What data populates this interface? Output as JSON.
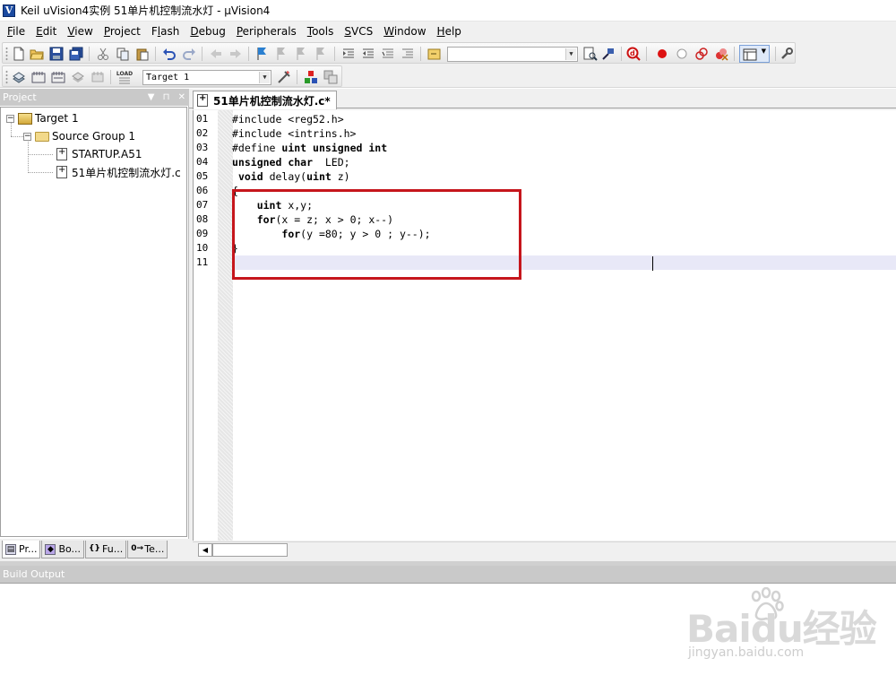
{
  "window": {
    "title": "Keil uVision4实例 51单片机控制流水灯  - µVision4"
  },
  "menu": {
    "items": [
      {
        "label": "File",
        "key": "F",
        "rest": "ile"
      },
      {
        "label": "Edit",
        "key": "E",
        "rest": "dit"
      },
      {
        "label": "View",
        "key": "V",
        "rest": "iew"
      },
      {
        "label": "Project",
        "key": "P",
        "rest": "roject"
      },
      {
        "label": "Flash",
        "key": "l",
        "pre": "F",
        "rest": "ash"
      },
      {
        "label": "Debug",
        "key": "D",
        "rest": "ebug"
      },
      {
        "label": "Peripherals",
        "key": "P",
        "rest": "eripherals"
      },
      {
        "label": "Tools",
        "key": "T",
        "rest": "ools"
      },
      {
        "label": "SVCS",
        "key": "S",
        "rest": "VCS"
      },
      {
        "label": "Window",
        "key": "W",
        "rest": "indow"
      },
      {
        "label": "Help",
        "key": "H",
        "rest": "elp"
      }
    ]
  },
  "toolbar": {
    "find_combo_value": "",
    "target_combo_value": "Target 1",
    "load_label": "LOAD"
  },
  "project_panel": {
    "title": "Project",
    "tree": {
      "target": "Target 1",
      "group": "Source Group 1",
      "files": [
        "STARTUP.A51",
        "51单片机控制流水灯.c"
      ]
    },
    "tabs": [
      "Pr...",
      "Bo...",
      "Fu...",
      "Te..."
    ]
  },
  "editor": {
    "tab_label": "51单片机控制流水灯.c*",
    "lines": [
      {
        "num": "01",
        "text": "#include <reg52.h>"
      },
      {
        "num": "02",
        "text": "#include <intrins.h>"
      },
      {
        "num": "03",
        "text": "#define uint unsigned int"
      },
      {
        "num": "04",
        "text": "unsigned char  LED;"
      },
      {
        "num": "05",
        "text": " void delay(uint z)"
      },
      {
        "num": "06",
        "text": "{"
      },
      {
        "num": "07",
        "text": "    uint x,y;"
      },
      {
        "num": "08",
        "text": "    for(x = z; x > 0; x--)"
      },
      {
        "num": "09",
        "text": "        for(y =80; y > 0 ; y--);"
      },
      {
        "num": "10",
        "text": "}"
      },
      {
        "num": "11",
        "text": ""
      }
    ],
    "current_line": "11",
    "highlight_color": "#c6161c"
  },
  "build_output": {
    "title": "Build Output"
  },
  "watermark": {
    "brand": "Baidu经验",
    "url": "jingyan.baidu.com"
  },
  "colors": {
    "panel_header": "#c9c9c9",
    "current_line_bg": "#e8e8f7"
  }
}
